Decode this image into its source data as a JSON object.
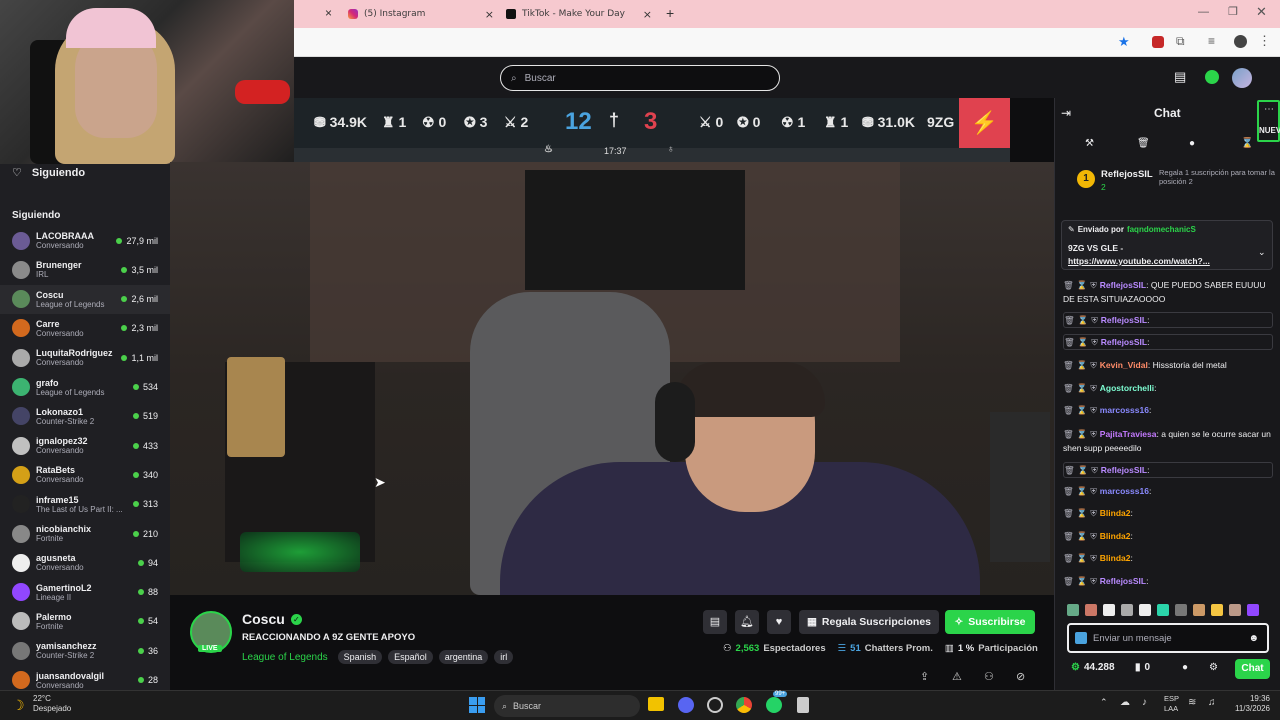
{
  "browser": {
    "tabs": [
      {
        "title": "(5) Instagram",
        "close": "×"
      },
      {
        "title": "TikTok - Make Your Day",
        "close": "×"
      }
    ],
    "first_tab_close": "×",
    "new_tab": "+"
  },
  "search": {
    "placeholder": "Buscar"
  },
  "sidebar": {
    "header": "Siguiendo",
    "section": "Siguiendo",
    "channels": [
      {
        "name": "LACOBRAAA",
        "category": "Conversando",
        "viewers": "27,9 mil",
        "color": "#6b5b95"
      },
      {
        "name": "Brunenger",
        "category": "IRL",
        "viewers": "3,5 mil",
        "color": "#8a8a8a"
      },
      {
        "name": "Coscu",
        "category": "League of Legends",
        "viewers": "2,6 mil",
        "color": "#5a8a5a"
      },
      {
        "name": "Carre",
        "category": "Conversando",
        "viewers": "2,3 mil",
        "color": "#d2691e"
      },
      {
        "name": "LuquitaRodriguez",
        "category": "Conversando",
        "viewers": "1,1 mil",
        "color": "#aaaaaa"
      },
      {
        "name": "grafo",
        "category": "League of Legends",
        "viewers": "534",
        "color": "#3cb371"
      },
      {
        "name": "Lokonazo1",
        "category": "Counter-Strike 2",
        "viewers": "519",
        "color": "#444466"
      },
      {
        "name": "ignalopez32",
        "category": "Conversando",
        "viewers": "433",
        "color": "#c0c0c0"
      },
      {
        "name": "RataBets",
        "category": "Conversando",
        "viewers": "340",
        "color": "#d4a017"
      },
      {
        "name": "inframe15",
        "category": "The Last of Us Part II: ...",
        "viewers": "313",
        "color": "#222222"
      },
      {
        "name": "nicobianchix",
        "category": "Fortnite",
        "viewers": "210",
        "color": "#888888"
      },
      {
        "name": "agusneta",
        "category": "Conversando",
        "viewers": "94",
        "color": "#eeeeee"
      },
      {
        "name": "GamertinoL2",
        "category": "Lineage II",
        "viewers": "88",
        "color": "#9147ff"
      },
      {
        "name": "Palermo",
        "category": "Fortnite",
        "viewers": "54",
        "color": "#bbbbbb"
      },
      {
        "name": "yamisanchezz",
        "category": "Counter-Strike 2",
        "viewers": "36",
        "color": "#777777"
      },
      {
        "name": "juansandovalgil",
        "category": "Conversando",
        "viewers": "28",
        "color": "#d2691e"
      }
    ]
  },
  "scoreboard": {
    "left_gold": "34.9K",
    "left_towers": "1",
    "left_dragons": "0",
    "left_barons": "3",
    "left_inhib": "2",
    "left_kills": "12",
    "right_kills": "3",
    "time": "17:37",
    "right_inhib": "0",
    "right_barons": "0",
    "right_dragons": "1",
    "right_towers": "1",
    "right_gold": "31.0K",
    "right_team": "9ZG"
  },
  "stream": {
    "channel": "Coscu",
    "title": "REACCIONANDO A 9Z GENTE APOYO",
    "category": "League of Legends",
    "tags": [
      "Spanish",
      "Español",
      "argentina",
      "irl"
    ],
    "live_badge": "LIVE",
    "gift_button": "Regala Suscripciones",
    "subscribe_button": "Suscribirse",
    "viewers": "2,563",
    "viewers_label": "Espectadores",
    "chatters": "51",
    "chatters_label": "Chatters Prom.",
    "participation": "1 %",
    "participation_label": "Participación"
  },
  "chat": {
    "title": "Chat",
    "top_gifter": {
      "rank": "1",
      "name": "ReflejosSIL",
      "count": "2",
      "text": "Regala 1 suscripción para tomar la posición 2"
    },
    "new_badge": "NUEV",
    "pinned": {
      "label": "Enviado por",
      "user": "faqndomechanicS",
      "message": "9ZG VS GLE -",
      "link": "https://www.youtube.com/watch?..."
    },
    "messages": [
      {
        "user": "ReflejosSIL",
        "text": "QUE PUEDO SABER EUUUU DE ESTA SITUIAZAOOOO",
        "color": "#b98bff"
      },
      {
        "user": "ReflejosSIL",
        "text": "",
        "color": "#b98bff"
      },
      {
        "user": "ReflejosSIL",
        "text": "",
        "color": "#b98bff"
      },
      {
        "user": "Kevin_Vidal",
        "text": "Hissstoria del metal",
        "color": "#ff8c69"
      },
      {
        "user": "Agostorchelli",
        "text": "",
        "color": "#7fffd4"
      },
      {
        "user": "marcosss16",
        "text": "",
        "color": "#8a8aff"
      },
      {
        "user": "PajitaTraviesa",
        "text": "a quien se le ocurre sacar un shen supp peeeedilo",
        "color": "#c47aff"
      },
      {
        "user": "ReflejosSIL",
        "text": "",
        "color": "#b98bff"
      },
      {
        "user": "marcosss16",
        "text": "",
        "color": "#8a8aff"
      },
      {
        "user": "Blinda2",
        "text": "",
        "color": "#ffa500"
      },
      {
        "user": "Blinda2",
        "text": "",
        "color": "#ffa500"
      },
      {
        "user": "Blinda2",
        "text": "",
        "color": "#ffa500"
      },
      {
        "user": "ReflejosSIL",
        "text": "",
        "color": "#b98bff"
      }
    ],
    "input_placeholder": "Enviar un mensaje",
    "points": "44.288",
    "bits": "0",
    "send_button": "Chat"
  },
  "taskbar": {
    "weather_temp": "22°C",
    "weather_text": "Despejado",
    "search_placeholder": "Buscar",
    "lang1": "ESP",
    "lang2": "LAA",
    "time": "19:36",
    "date": "11/3/2026",
    "badge": "99+"
  },
  "colors": {
    "accent": "#9147ff",
    "subscribe": "#2bd44a",
    "live": "#4bd04b",
    "gold": "#f2b705"
  }
}
